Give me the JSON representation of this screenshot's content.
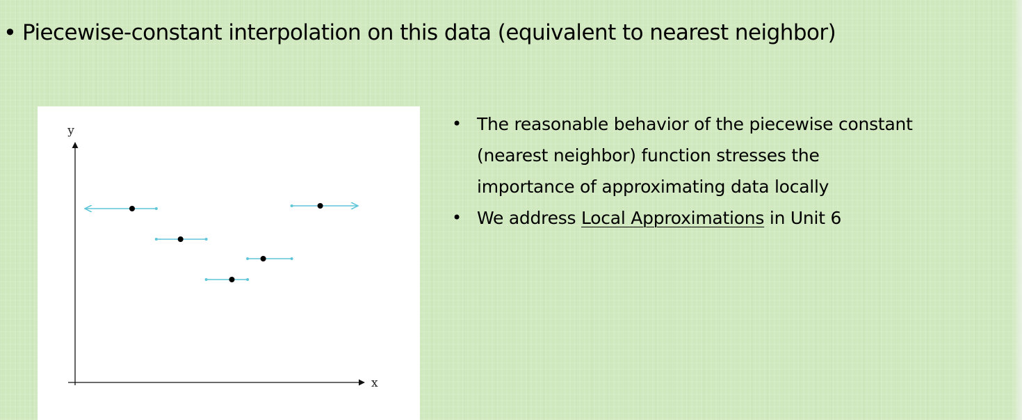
{
  "title": {
    "bullet": "•",
    "text": "Piecewise-constant interpolation on this data (equivalent to nearest neighbor)"
  },
  "bullets": [
    {
      "dot": "•",
      "lines": [
        "The reasonable behavior of the piecewise constant",
        "(nearest neighbor) function stresses the",
        "importance of approximating data locally"
      ]
    },
    {
      "dot": "•",
      "before": "We address ",
      "link": "Local Approximations",
      "after": " in Unit 6"
    }
  ],
  "chart_data": {
    "type": "scatter",
    "xlabel": "x",
    "ylabel": "y",
    "points": [
      {
        "x": 2.0,
        "y": 6.2
      },
      {
        "x": 3.7,
        "y": 5.1
      },
      {
        "x": 5.5,
        "y": 3.65
      },
      {
        "x": 6.6,
        "y": 4.4
      },
      {
        "x": 8.6,
        "y": 6.3
      }
    ],
    "steps": [
      {
        "from": null,
        "to": 2.85,
        "y": 6.2
      },
      {
        "from": 2.85,
        "to": 4.6,
        "y": 5.1
      },
      {
        "from": 4.6,
        "to": 6.05,
        "y": 3.65
      },
      {
        "from": 6.05,
        "to": 7.6,
        "y": 4.4
      },
      {
        "from": 7.6,
        "to": null,
        "y": 6.3
      }
    ],
    "colors": {
      "steps": "#5fc6d8",
      "points": "#000000",
      "axes": "#111111"
    }
  }
}
